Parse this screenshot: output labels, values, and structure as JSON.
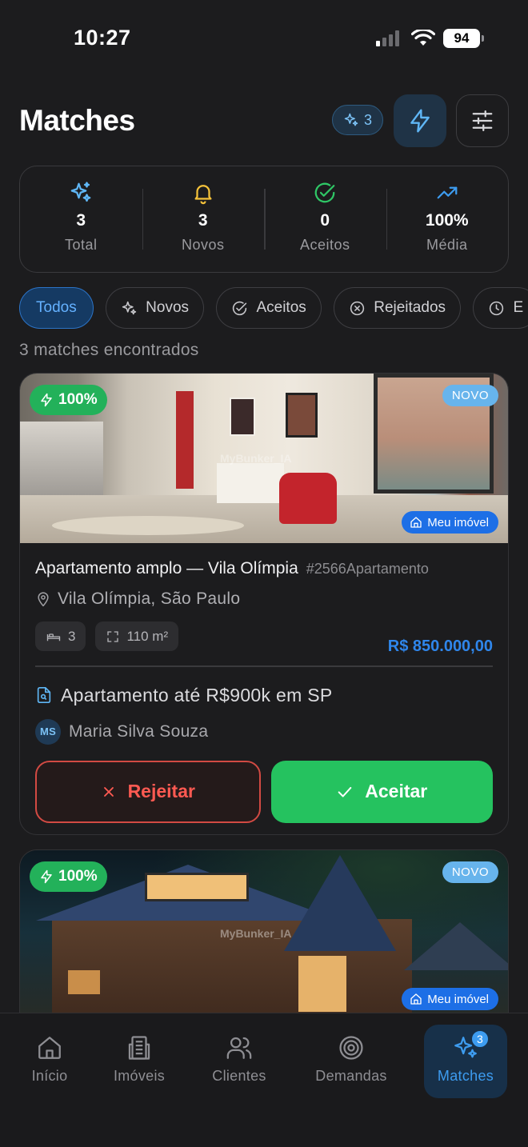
{
  "status_bar": {
    "time": "10:27",
    "battery": "94"
  },
  "header": {
    "title": "Matches",
    "ai_chip_count": "3"
  },
  "stats": [
    {
      "icon": "sparkles-icon",
      "value": "3",
      "label": "Total",
      "color": "#5fb6f5"
    },
    {
      "icon": "bell-icon",
      "value": "3",
      "label": "Novos",
      "color": "#f5c23a"
    },
    {
      "icon": "check-circle-icon",
      "value": "0",
      "label": "Aceitos",
      "color": "#2fc766"
    },
    {
      "icon": "trending-up-icon",
      "value": "100%",
      "label": "Média",
      "color": "#3d9cf0"
    }
  ],
  "filters": [
    {
      "label": "Todos",
      "icon": "",
      "active": true
    },
    {
      "label": "Novos",
      "icon": "sparkles-icon",
      "active": false
    },
    {
      "label": "Aceitos",
      "icon": "check-circle-icon",
      "active": false
    },
    {
      "label": "Rejeitados",
      "icon": "x-circle-icon",
      "active": false
    },
    {
      "label": "E",
      "icon": "clock-icon",
      "active": false
    }
  ],
  "results_count": "3 matches encontrados",
  "matches": [
    {
      "score": "100%",
      "new_label": "NOVO",
      "owner_label": "Meu imóvel",
      "watermark": "MyBunker_IA",
      "title": "Apartamento amplo — Vila Olímpia",
      "code": "#2566Apartamento",
      "location": "Vila Olímpia, São Paulo",
      "bedrooms": "3",
      "area": "110 m²",
      "price": "R$ 850.000,00",
      "demand": "Apartamento até R$900k em SP",
      "client_initials": "MS",
      "client_name": "Maria Silva Souza",
      "reject_label": "Rejeitar",
      "accept_label": "Aceitar"
    },
    {
      "score": "100%",
      "new_label": "NOVO",
      "owner_label": "Meu imóvel",
      "watermark": "MyBunker_IA"
    }
  ],
  "tab_bar": [
    {
      "label": "Início",
      "icon": "home-icon",
      "active": false
    },
    {
      "label": "Imóveis",
      "icon": "building-icon",
      "active": false
    },
    {
      "label": "Clientes",
      "icon": "users-icon",
      "active": false
    },
    {
      "label": "Demandas",
      "icon": "target-icon",
      "active": false
    },
    {
      "label": "Matches",
      "icon": "sparkles-icon",
      "active": true,
      "badge": "3"
    }
  ],
  "colors": {
    "background": "#1c1c1e",
    "accent": "#3d9cf0",
    "success": "#25c25f",
    "danger": "#ff5a52"
  }
}
